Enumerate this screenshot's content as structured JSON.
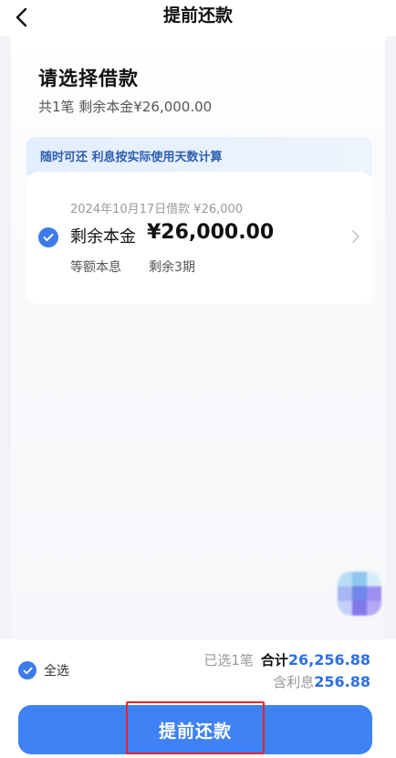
{
  "header": {
    "title": "提前还款"
  },
  "page": {
    "heading": "请选择借款",
    "summary": "共1笔 剩余本金¥26,000.00"
  },
  "notice": "随时可还 利息按实际使用天数计算",
  "loan": {
    "meta": "2024年10月17日借款 ¥26,000",
    "principal_label": "剩余本金",
    "principal_amount": "¥26,000.00",
    "method": "等额本息",
    "periods": "剩余3期",
    "selected": true
  },
  "footer": {
    "select_all": "全选",
    "selected_prefix": "已选",
    "selected_count": "1",
    "selected_unit": "笔",
    "total_label": "合计",
    "total_amount": "26,256.88",
    "interest_label": "含利息",
    "interest_amount": "256.88",
    "button": "提前还款"
  },
  "colors": {
    "accent": "#3e82f5",
    "amount": "#2e6fe0",
    "highlight_box": "#e0262b"
  },
  "icons": [
    "back-arrow-icon",
    "check-icon",
    "chevron-right-icon"
  ]
}
